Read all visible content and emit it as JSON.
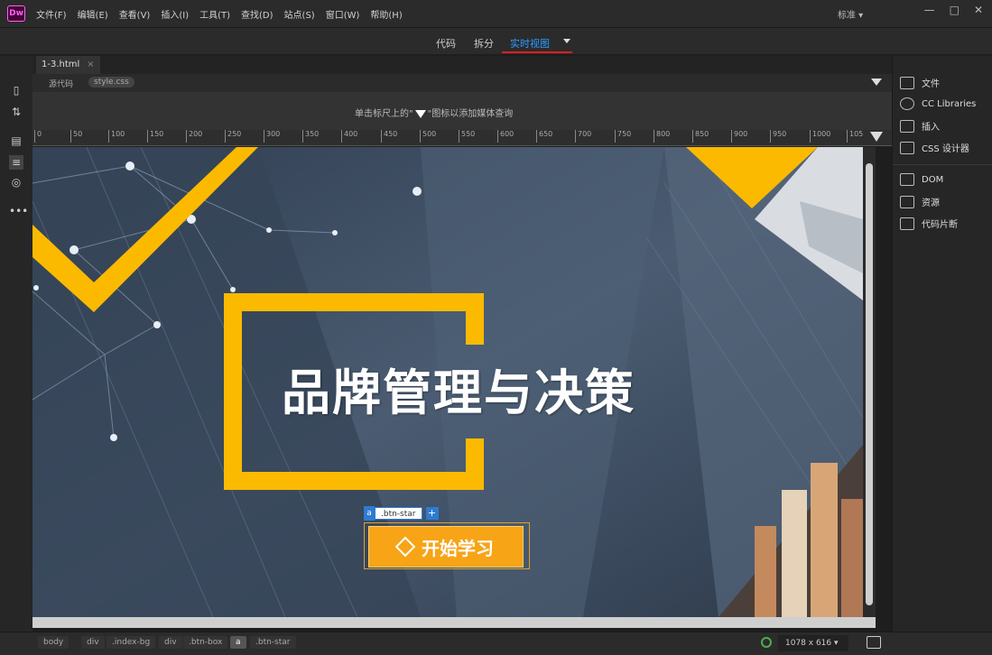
{
  "menubar": {
    "logo": "Dw",
    "menus": [
      "文件(F)",
      "编辑(E)",
      "查看(V)",
      "插入(I)",
      "工具(T)",
      "查找(D)",
      "站点(S)",
      "窗口(W)",
      "帮助(H)"
    ],
    "workspace": "标准",
    "controls": [
      "—",
      "□",
      "✕"
    ]
  },
  "viewbar": {
    "code": "代码",
    "split": "拆分",
    "live": "实时视图"
  },
  "doc": {
    "file_tab": "1-3.html",
    "close": "×",
    "source_tabs": [
      "源代码",
      "style.css"
    ],
    "mq_hint_before": "单击标尺上的\"",
    "mq_hint_after": "\"图标以添加媒体查询",
    "ruler_ticks": [
      "0",
      "50",
      "100",
      "150",
      "200",
      "250",
      "300",
      "350",
      "400",
      "450",
      "500",
      "550",
      "600",
      "650",
      "700",
      "750",
      "800",
      "850",
      "900",
      "950",
      "1000",
      "105"
    ]
  },
  "live": {
    "title": "品牌管理与决策",
    "button_label": "开始学习",
    "selection_tag": "a",
    "selection_class": ".btn-star",
    "selection_plus": "+",
    "colors": {
      "accent": "#fbba00",
      "button": "#f7a416",
      "background": "#3f4f63"
    }
  },
  "panel": {
    "items": [
      "文件",
      "CC Libraries",
      "插入",
      "CSS 设计器",
      "DOM",
      "资源",
      "代码片断"
    ]
  },
  "status": {
    "crumbs": [
      "body",
      "div",
      ".index-bg",
      "div",
      ".btn-box",
      "a",
      ".btn-star"
    ],
    "size": "1078 x 616"
  }
}
